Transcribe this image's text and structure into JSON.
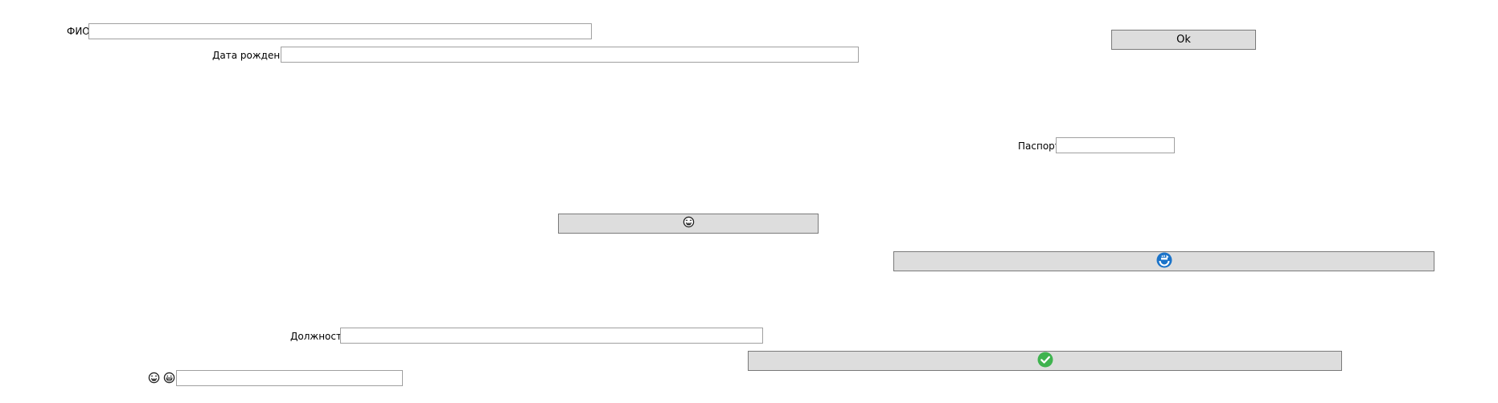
{
  "form": {
    "fio_label": "ФИО",
    "fio_value": "",
    "birthdate_label": "Дата рождения",
    "birthdate_value": "",
    "passport_label": "Паспорт",
    "passport_value": "",
    "position_label": "Должность",
    "position_value": "",
    "emoji_field_value": ""
  },
  "buttons": {
    "ok_label": "Ok",
    "emoji_button_icon": "laughing-face-icon",
    "refresh_button_icon": "refresh-icon",
    "check_button_icon": "check-circle-icon"
  },
  "icons": {
    "emoji_label_icons": [
      "laughing-face-icon",
      "grinning-face-icon"
    ]
  },
  "colors": {
    "button_bg": "#dddddd",
    "refresh_blue": "#1a73c9",
    "check_green": "#3fb34f"
  }
}
